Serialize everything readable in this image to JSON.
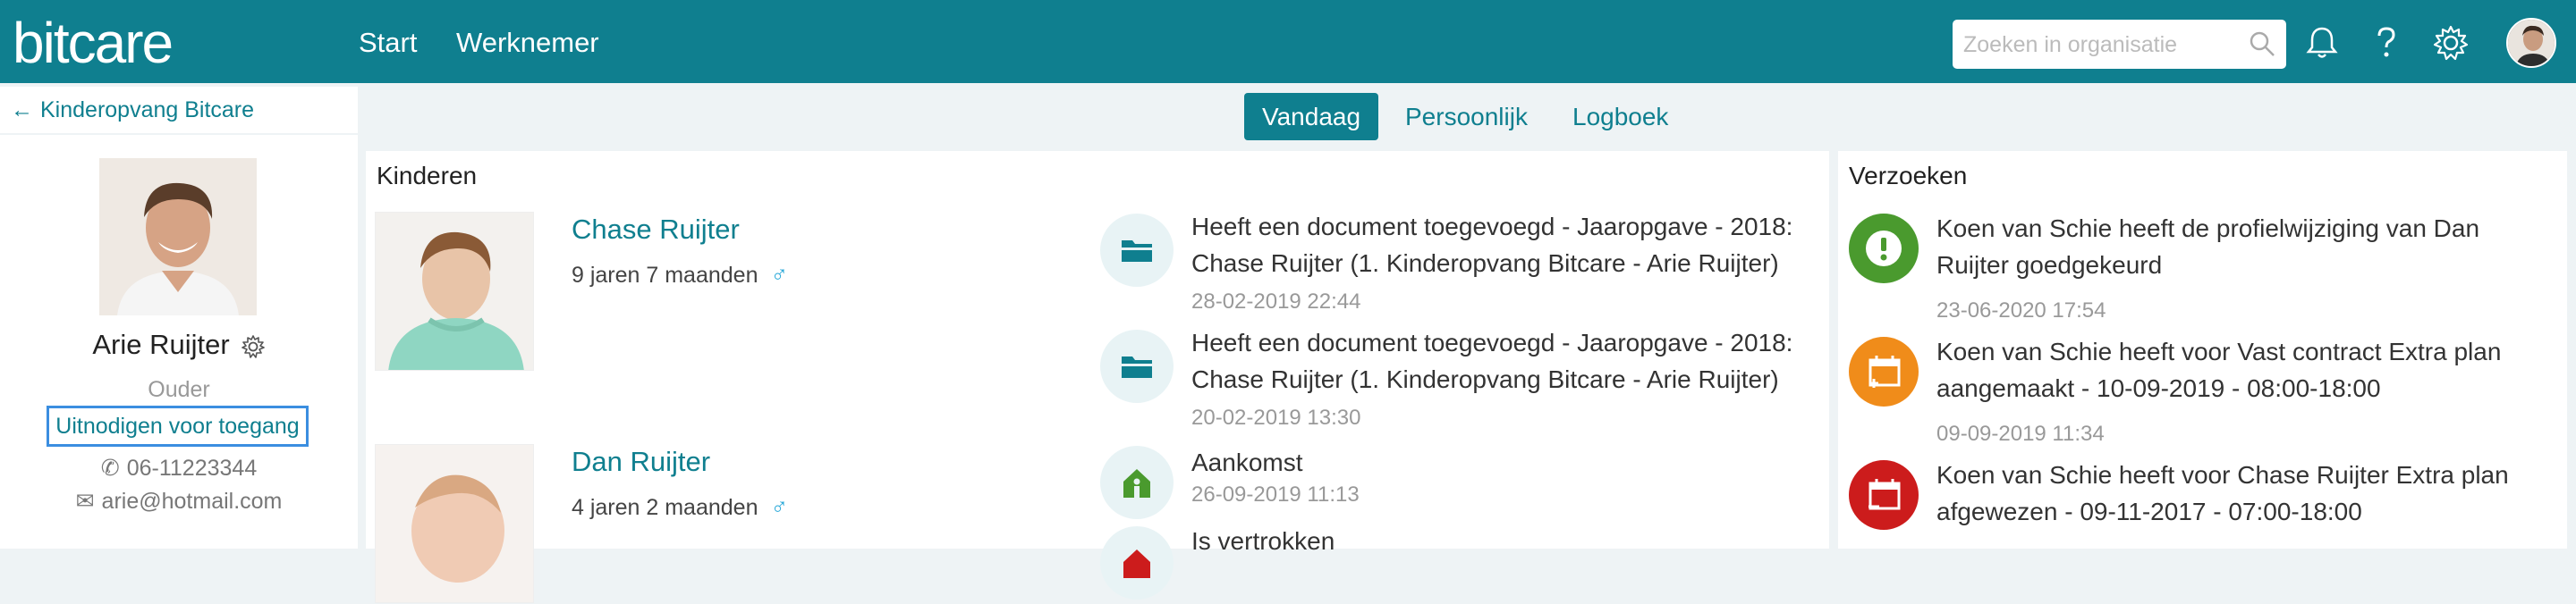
{
  "app": {
    "logo": "bitcare"
  },
  "nav": {
    "items": [
      "Start",
      "Werknemer"
    ]
  },
  "search": {
    "placeholder": "Zoeken in organisatie"
  },
  "sidebar": {
    "back_label": "Kinderopvang Bitcare",
    "profile": {
      "name": "Arie Ruijter",
      "role": "Ouder",
      "invite_label": "Uitnodigen voor toegang",
      "phone": "06-11223344",
      "email": "arie@hotmail.com"
    }
  },
  "tabs": [
    {
      "label": "Vandaag",
      "active": true
    },
    {
      "label": "Persoonlijk",
      "active": false
    },
    {
      "label": "Logboek",
      "active": false
    }
  ],
  "children_panel": {
    "title": "Kinderen",
    "children": [
      {
        "name": "Chase Ruijter",
        "age": "9 jaren 7 maanden",
        "gender_symbol": "♂"
      },
      {
        "name": "Dan Ruijter",
        "age": "4 jaren 2 maanden",
        "gender_symbol": "♂"
      }
    ],
    "activities": [
      {
        "icon": "folder-icon",
        "text": "Heeft een document toegevoegd - Jaaropgave - 2018: Chase Ruijter (1. Kinderopvang Bitcare - Arie Ruijter)",
        "time": "28-02-2019 22:44"
      },
      {
        "icon": "folder-icon",
        "text": "Heeft een document toegevoegd - Jaaropgave - 2018: Chase Ruijter (1. Kinderopvang Bitcare - Arie Ruijter)",
        "time": "20-02-2019 13:30"
      },
      {
        "icon": "arrival-icon",
        "text": "Aankomst",
        "time": "26-09-2019 11:13"
      },
      {
        "icon": "departure-icon",
        "text": "Is vertrokken",
        "time": ""
      }
    ]
  },
  "requests_panel": {
    "title": "Verzoeken",
    "requests": [
      {
        "icon": "exclamation-icon",
        "color": "#4a9a2e",
        "text": "Koen van Schie heeft de profielwijziging van Dan Ruijter goedgekeurd",
        "time": "23-06-2020 17:54"
      },
      {
        "icon": "calendar-add-icon",
        "color": "#f08c1a",
        "text": "Koen van Schie heeft voor Vast contract Extra plan aangemaakt - 10-09-2019 - 08:00-18:00",
        "time": "09-09-2019 11:34"
      },
      {
        "icon": "calendar-reject-icon",
        "color": "#cc1c1c",
        "text": "Koen van Schie heeft voor Chase Ruijter Extra plan afgewezen - 09-11-2017 - 07:00-18:00",
        "time": ""
      }
    ]
  },
  "colors": {
    "brand": "#0f7f8f",
    "link": "#0f7f8f",
    "invite_border": "#3b8ee0"
  }
}
